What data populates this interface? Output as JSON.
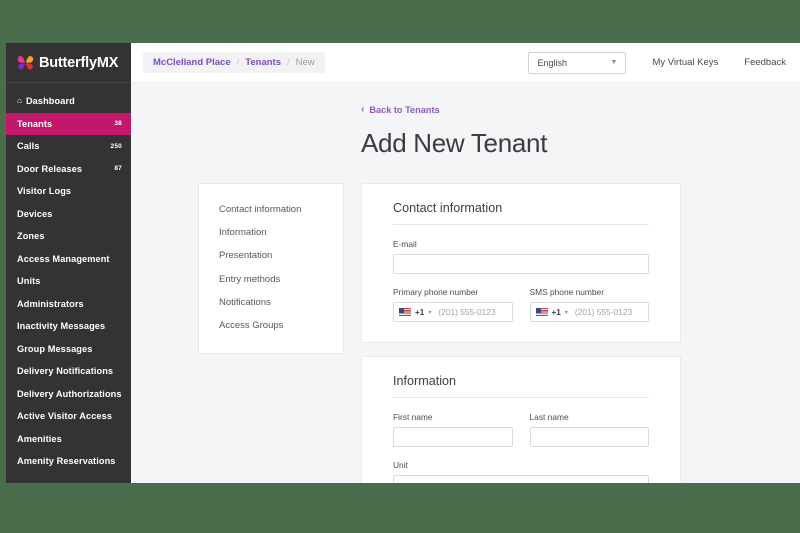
{
  "brand": {
    "name": "ButterflyMX",
    "accent": "#c2176b",
    "link": "#7c4dbe"
  },
  "sidebar": {
    "items": [
      {
        "label": "Dashboard",
        "icon": "home-icon",
        "badge": "",
        "active": false
      },
      {
        "label": "Tenants",
        "icon": "",
        "badge": "38",
        "active": true
      },
      {
        "label": "Calls",
        "icon": "",
        "badge": "250",
        "active": false
      },
      {
        "label": "Door Releases",
        "icon": "",
        "badge": "87",
        "active": false
      },
      {
        "label": "Visitor Logs",
        "icon": "",
        "badge": "",
        "active": false
      },
      {
        "label": "Devices",
        "icon": "",
        "badge": "",
        "active": false
      },
      {
        "label": "Zones",
        "icon": "",
        "badge": "",
        "active": false
      },
      {
        "label": "Access Management",
        "icon": "",
        "badge": "",
        "active": false
      },
      {
        "label": "Units",
        "icon": "",
        "badge": "",
        "active": false
      },
      {
        "label": "Administrators",
        "icon": "",
        "badge": "",
        "active": false
      },
      {
        "label": "Inactivity Messages",
        "icon": "",
        "badge": "",
        "active": false
      },
      {
        "label": "Group Messages",
        "icon": "",
        "badge": "",
        "active": false
      },
      {
        "label": "Delivery Notifications",
        "icon": "",
        "badge": "",
        "active": false
      },
      {
        "label": "Delivery Authorizations",
        "icon": "",
        "badge": "",
        "active": false
      },
      {
        "label": "Active Visitor Access",
        "icon": "",
        "badge": "",
        "active": false
      },
      {
        "label": "Amenities",
        "icon": "",
        "badge": "",
        "active": false
      },
      {
        "label": "Amenity Reservations",
        "icon": "",
        "badge": "",
        "active": false
      }
    ]
  },
  "topbar": {
    "breadcrumb": {
      "property": "McClelland Place",
      "section": "Tenants",
      "current": "New",
      "separator": "/"
    },
    "language": {
      "value": "English",
      "caret": "▼"
    },
    "virtual_keys_label": "My Virtual Keys",
    "feedback_label": "Feedback"
  },
  "page": {
    "back_link": "Back to Tenants",
    "back_chevron": "‹",
    "title": "Add New Tenant"
  },
  "section_nav": {
    "items": [
      "Contact information",
      "Information",
      "Presentation",
      "Entry methods",
      "Notifications",
      "Access Groups"
    ]
  },
  "contact_card": {
    "title": "Contact information",
    "email": {
      "label": "E-mail",
      "value": "",
      "placeholder": ""
    },
    "primary_phone": {
      "label": "Primary phone number",
      "country_code": "+1",
      "caret": "▾",
      "placeholder": "(201) 555-0123",
      "value": ""
    },
    "sms_phone": {
      "label": "SMS phone number",
      "country_code": "+1",
      "caret": "▾",
      "placeholder": "(201) 555-0123",
      "value": ""
    }
  },
  "information_card": {
    "title": "Information",
    "first_name": {
      "label": "First name",
      "value": "",
      "placeholder": ""
    },
    "last_name": {
      "label": "Last name",
      "value": "",
      "placeholder": ""
    },
    "unit": {
      "label": "Unit",
      "value": "",
      "placeholder": ""
    }
  }
}
